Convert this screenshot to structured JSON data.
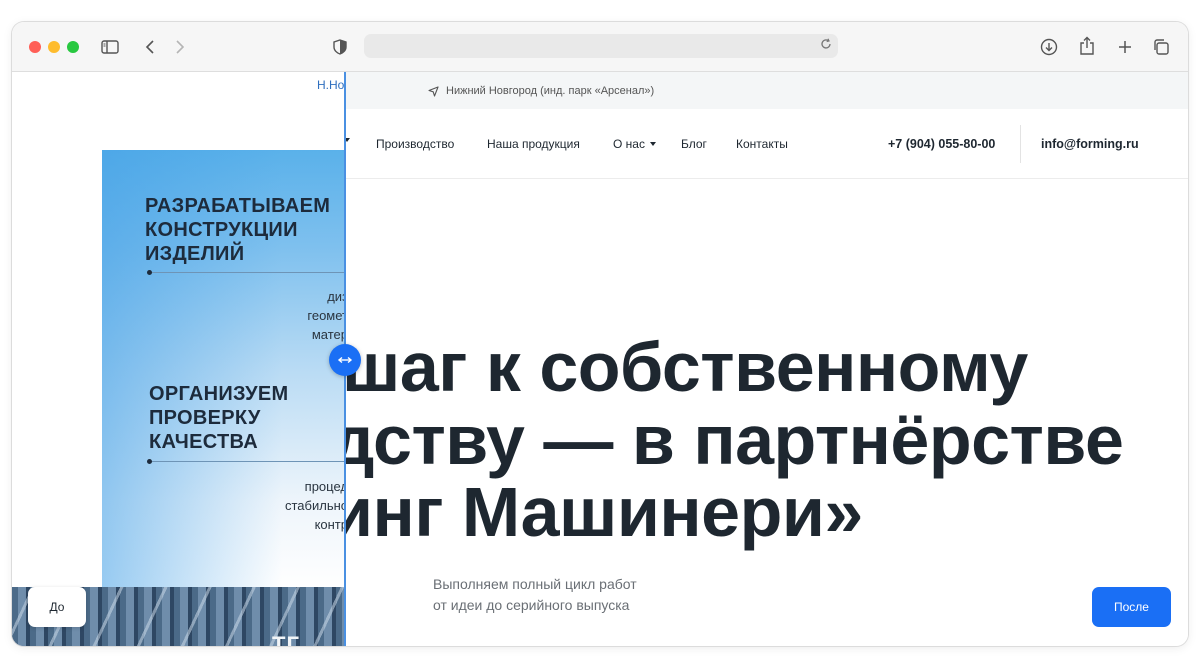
{
  "browser": {
    "toolbar_icons": [
      "sidebar-icon",
      "back-icon",
      "forward-icon",
      "shield-icon",
      "reload-icon",
      "download-icon",
      "share-icon",
      "new-tab-icon",
      "tab-overview-icon"
    ],
    "url": ""
  },
  "after_site": {
    "location": "Нижний Новгород (инд. парк «Арсенал»)",
    "nav": {
      "items": [
        {
          "label": "Производство"
        },
        {
          "label": "Наша продукция"
        },
        {
          "label": "О нас"
        },
        {
          "label": "Блог"
        },
        {
          "label": "Контакты"
        }
      ],
      "phone": "+7 (904) 055-80-00",
      "email": "info@forming.ru"
    },
    "hero": {
      "line1": "шаг к собственному",
      "line2": "дству — в партнёрстве",
      "line3": "инг Машинери»"
    },
    "subtitle": {
      "line1": "Выполняем полный цикл работ",
      "line2": "от идеи до серийного выпуска"
    }
  },
  "before_site": {
    "top_text": "Н.Но",
    "block1": {
      "heading": "РАЗРАБАТЫВАЕМ\nКОНСТРУКЦИИ\nИЗДЕЛИЙ",
      "text": "диз\nгеомет\nматер"
    },
    "block2": {
      "heading": "ОРГАНИЗУЕМ\nПРОВЕРКУ\nКАЧЕСТВА",
      "text": "процед\nстабильно\nконтр"
    },
    "factory_text": "ТГ"
  },
  "comparison": {
    "before_label": "До",
    "after_label": "После"
  },
  "colors": {
    "accent": "#1a6ff5",
    "text_dark": "#1e2730",
    "divider": "#4a90e2"
  }
}
